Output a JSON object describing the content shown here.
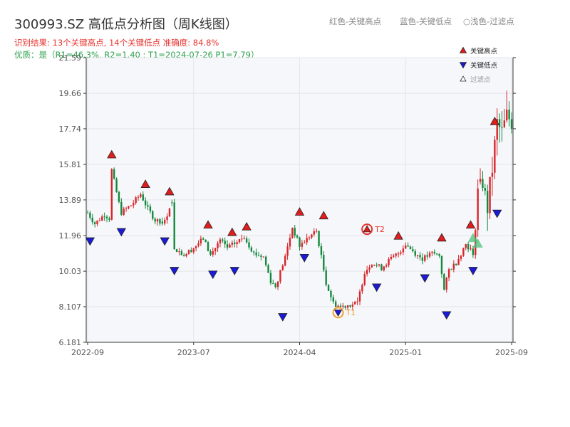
{
  "title": "300993.SZ 高低点分析图（周K线图）",
  "subtitle_result": "识别结果: 13个关键高点, 14个关键低点  准确度: 84.8%",
  "subtitle_quality": "优质：是（R1=46.3%, R2=1.40 ; T1=2024-07-26 P1=7.79）",
  "top_legend": {
    "red": "红色-关键高点",
    "blue": "蓝色-关键低点",
    "light": "浅色-过滤点"
  },
  "chart_data": {
    "type": "candlestick",
    "y_ticks": [
      "6.181",
      "8.107",
      "10.03",
      "11.96",
      "13.89",
      "15.81",
      "17.74",
      "19.66",
      "21.59"
    ],
    "y_range": [
      6.181,
      21.59
    ],
    "x_ticks": [
      {
        "label": "2022-09",
        "idx": 0
      },
      {
        "label": "2023-07",
        "idx": 44
      },
      {
        "label": "2024-04",
        "idx": 88
      },
      {
        "label": "2025-01",
        "idx": 132
      },
      {
        "label": "2025-09",
        "idx": 176
      }
    ],
    "x_count": 177,
    "legend": [
      {
        "label": "关键高点",
        "kind": "high"
      },
      {
        "label": "关键低点",
        "kind": "low"
      },
      {
        "label": "过滤点",
        "kind": "filtered"
      }
    ],
    "anchors": [
      [
        0,
        13.2
      ],
      [
        3,
        12.6
      ],
      [
        7,
        13.1
      ],
      [
        9,
        12.9
      ],
      [
        10,
        15.5
      ],
      [
        13,
        13.7
      ],
      [
        14,
        13.2
      ],
      [
        18,
        13.6
      ],
      [
        22,
        14.2
      ],
      [
        25,
        13.4
      ],
      [
        28,
        12.8
      ],
      [
        32,
        12.7
      ],
      [
        34,
        13.5
      ],
      [
        35,
        13.7
      ],
      [
        36,
        11.3
      ],
      [
        40,
        10.9
      ],
      [
        44,
        11.3
      ],
      [
        48,
        11.8
      ],
      [
        51,
        10.9
      ],
      [
        55,
        11.7
      ],
      [
        58,
        11.3
      ],
      [
        62,
        11.6
      ],
      [
        65,
        11.9
      ],
      [
        69,
        11.0
      ],
      [
        73,
        10.8
      ],
      [
        76,
        9.5
      ],
      [
        78,
        9.2
      ],
      [
        82,
        10.8
      ],
      [
        85,
        12.4
      ],
      [
        88,
        11.4
      ],
      [
        92,
        11.9
      ],
      [
        95,
        12.2
      ],
      [
        99,
        9.4
      ],
      [
        102,
        8.3
      ],
      [
        105,
        8.1
      ],
      [
        108,
        8.2
      ],
      [
        112,
        8.3
      ],
      [
        115,
        10.0
      ],
      [
        118,
        10.5
      ],
      [
        122,
        10.2
      ],
      [
        125,
        10.6
      ],
      [
        129,
        11.0
      ],
      [
        132,
        11.5
      ],
      [
        136,
        11.0
      ],
      [
        139,
        10.7
      ],
      [
        143,
        11.0
      ],
      [
        146,
        10.9
      ],
      [
        148,
        9.0
      ],
      [
        150,
        10.1
      ],
      [
        153,
        10.5
      ],
      [
        157,
        11.5
      ],
      [
        159,
        11.2
      ],
      [
        160,
        10.8
      ],
      [
        162,
        14.5
      ],
      [
        164,
        14.8
      ],
      [
        166,
        13.5
      ],
      [
        168,
        15.6
      ],
      [
        170,
        18.0
      ],
      [
        172,
        17.5
      ],
      [
        174,
        18.4
      ],
      [
        176,
        18.2
      ]
    ],
    "gaps": [
      31,
      35,
      163
    ],
    "key_highs": [
      {
        "i": 10,
        "v": 16.1
      },
      {
        "i": 24,
        "v": 14.5
      },
      {
        "i": 34,
        "v": 14.1
      },
      {
        "i": 50,
        "v": 12.3
      },
      {
        "i": 60,
        "v": 11.9
      },
      {
        "i": 66,
        "v": 12.2
      },
      {
        "i": 88,
        "v": 13.0
      },
      {
        "i": 98,
        "v": 12.8
      },
      {
        "i": 129,
        "v": 11.7
      },
      {
        "i": 147,
        "v": 11.6
      },
      {
        "i": 159,
        "v": 12.3
      },
      {
        "i": 169,
        "v": 17.9
      }
    ],
    "key_lows": [
      {
        "i": 1,
        "v": 11.9
      },
      {
        "i": 14,
        "v": 12.4
      },
      {
        "i": 32,
        "v": 11.9
      },
      {
        "i": 36,
        "v": 10.3
      },
      {
        "i": 52,
        "v": 10.1
      },
      {
        "i": 61,
        "v": 10.3
      },
      {
        "i": 81,
        "v": 7.8
      },
      {
        "i": 90,
        "v": 11.0
      },
      {
        "i": 120,
        "v": 9.4
      },
      {
        "i": 140,
        "v": 9.9
      },
      {
        "i": 149,
        "v": 7.9
      },
      {
        "i": 160,
        "v": 10.3
      },
      {
        "i": 170,
        "v": 13.4
      }
    ],
    "filtered": [
      {
        "i": 160,
        "v": 11.8
      },
      {
        "i": 162,
        "v": 11.5
      }
    ],
    "key_marks": [
      {
        "label": "T1",
        "i": 104,
        "v": 7.79,
        "color": "#f0a030",
        "kind": "low"
      },
      {
        "label": "T2",
        "i": 116,
        "v": 12.3,
        "color": "#e8322e",
        "kind": "high"
      }
    ],
    "colors": {
      "up": "#d8262b",
      "down": "#15883d",
      "high": "#e11d1d",
      "low": "#1a1ad8",
      "plot_bg": "#f5f7fa"
    }
  }
}
